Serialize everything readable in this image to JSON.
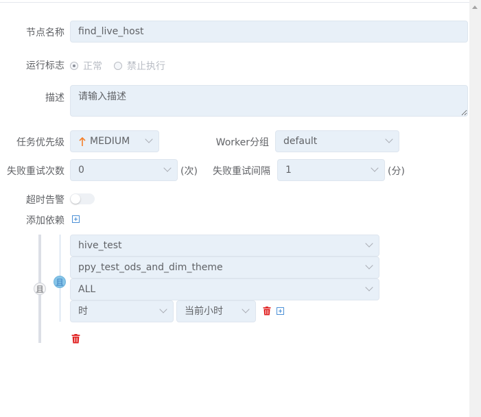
{
  "form": {
    "node_name": {
      "label": "节点名称",
      "value": "find_live_host"
    },
    "run_flag": {
      "label": "运行标志",
      "options": [
        "正常",
        "禁止执行"
      ],
      "selected": "正常"
    },
    "description": {
      "label": "描述",
      "placeholder": "请输入描述"
    },
    "priority": {
      "label": "任务优先级",
      "value": "MEDIUM",
      "icon": "arrow-up-icon",
      "icon_color": "#f5802a"
    },
    "worker_group": {
      "label": "Worker分组",
      "value": "default"
    },
    "retry_times": {
      "label": "失败重试次数",
      "value": "0",
      "unit": "(次)"
    },
    "retry_interval": {
      "label": "失败重试间隔",
      "value": "1",
      "unit": "(分)"
    },
    "timeout_alarm": {
      "label": "超时告警",
      "enabled": false
    },
    "add_dependency": {
      "label": "添加依赖"
    }
  },
  "dependency": {
    "outer_relation": "且",
    "inner_relation": "且",
    "project": "hive_test",
    "definition": "ppy_test_ods_and_dim_theme",
    "task": "ALL",
    "cycle": "时",
    "date": "当前小时"
  },
  "colors": {
    "input_bg": "#e8f0f8",
    "delete_red": "#e02020",
    "plus_blue": "#4a8fd6"
  }
}
